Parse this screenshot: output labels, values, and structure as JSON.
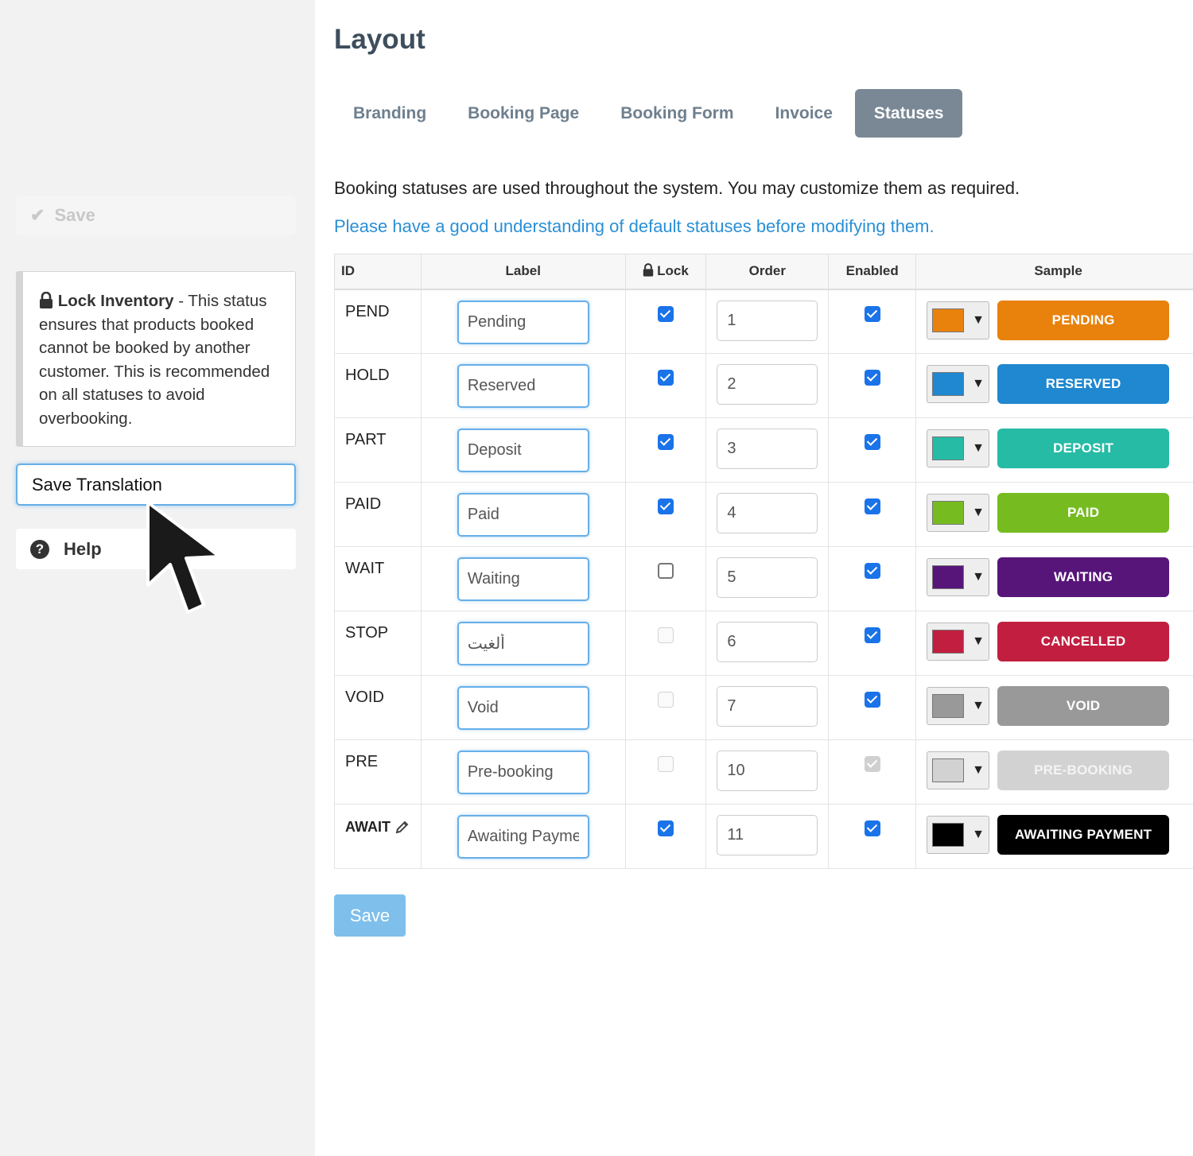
{
  "sidebar": {
    "save_label": "Save",
    "info_title": "Lock Inventory",
    "info_text": " - This status ensures that products booked cannot be booked by another customer. This is recommended on all statuses to avoid overbooking.",
    "translation_value": "Save Translation",
    "help_label": "Help"
  },
  "main": {
    "title": "Layout",
    "tabs": [
      {
        "label": "Branding",
        "active": false
      },
      {
        "label": "Booking Page",
        "active": false
      },
      {
        "label": "Booking Form",
        "active": false
      },
      {
        "label": "Invoice",
        "active": false
      },
      {
        "label": "Statuses",
        "active": true
      }
    ],
    "intro": "Booking statuses are used throughout the system. You may customize them as required.",
    "warning_link": "Please have a good understanding of default statuses before modifying them.",
    "columns": {
      "id": "ID",
      "label": "Label",
      "lock": "Lock",
      "order": "Order",
      "enabled": "Enabled",
      "sample": "Sample"
    },
    "rows": [
      {
        "id": "PEND",
        "label": "Pending",
        "lock": "checked",
        "order": "1",
        "enabled": "checked",
        "color": "#e8820c",
        "sample": "PENDING",
        "text_color": "#ffffff"
      },
      {
        "id": "HOLD",
        "label": "Reserved",
        "lock": "checked",
        "order": "2",
        "enabled": "checked",
        "color": "#1f88d0",
        "sample": "RESERVED",
        "text_color": "#ffffff"
      },
      {
        "id": "PART",
        "label": "Deposit",
        "lock": "checked",
        "order": "3",
        "enabled": "checked",
        "color": "#26bba5",
        "sample": "DEPOSIT",
        "text_color": "#ffffff"
      },
      {
        "id": "PAID",
        "label": "Paid",
        "lock": "checked",
        "order": "4",
        "enabled": "checked",
        "color": "#76bc21",
        "sample": "PAID",
        "text_color": "#ffffff"
      },
      {
        "id": "WAIT",
        "label": "Waiting",
        "lock": "unchecked",
        "order": "5",
        "enabled": "checked",
        "color": "#57157a",
        "sample": "WAITING",
        "text_color": "#ffffff"
      },
      {
        "id": "STOP",
        "label": "ألغيت",
        "lock": "disabled-unchecked",
        "order": "6",
        "enabled": "checked",
        "color": "#c21f40",
        "sample": "CANCELLED",
        "text_color": "#ffffff"
      },
      {
        "id": "VOID",
        "label": "Void",
        "lock": "disabled-unchecked",
        "order": "7",
        "enabled": "checked",
        "color": "#999999",
        "sample": "VOID",
        "text_color": "#ffffff"
      },
      {
        "id": "PRE",
        "label": "Pre-booking",
        "lock": "disabled-unchecked",
        "order": "10",
        "enabled": "disabled-checked",
        "color": "#d2d2d2",
        "sample": "PRE-BOOKING",
        "text_color": "#f4f4f4"
      },
      {
        "id": "AWAIT",
        "label": "Awaiting Payme",
        "lock": "checked",
        "order": "11",
        "enabled": "checked",
        "color": "#000000",
        "sample": "AWAITING PAYMENT",
        "text_color": "#ffffff",
        "edited": true
      }
    ],
    "save_label": "Save"
  },
  "icons": {
    "lock": "lock-icon",
    "help": "question-circle-icon",
    "pencil": "pencil-icon",
    "check": "check-icon",
    "cursor": "mouse-cursor-icon"
  },
  "colors": {
    "link": "#2a8fd6",
    "tab_active": "#7a8896",
    "focus": "#66afe9"
  }
}
